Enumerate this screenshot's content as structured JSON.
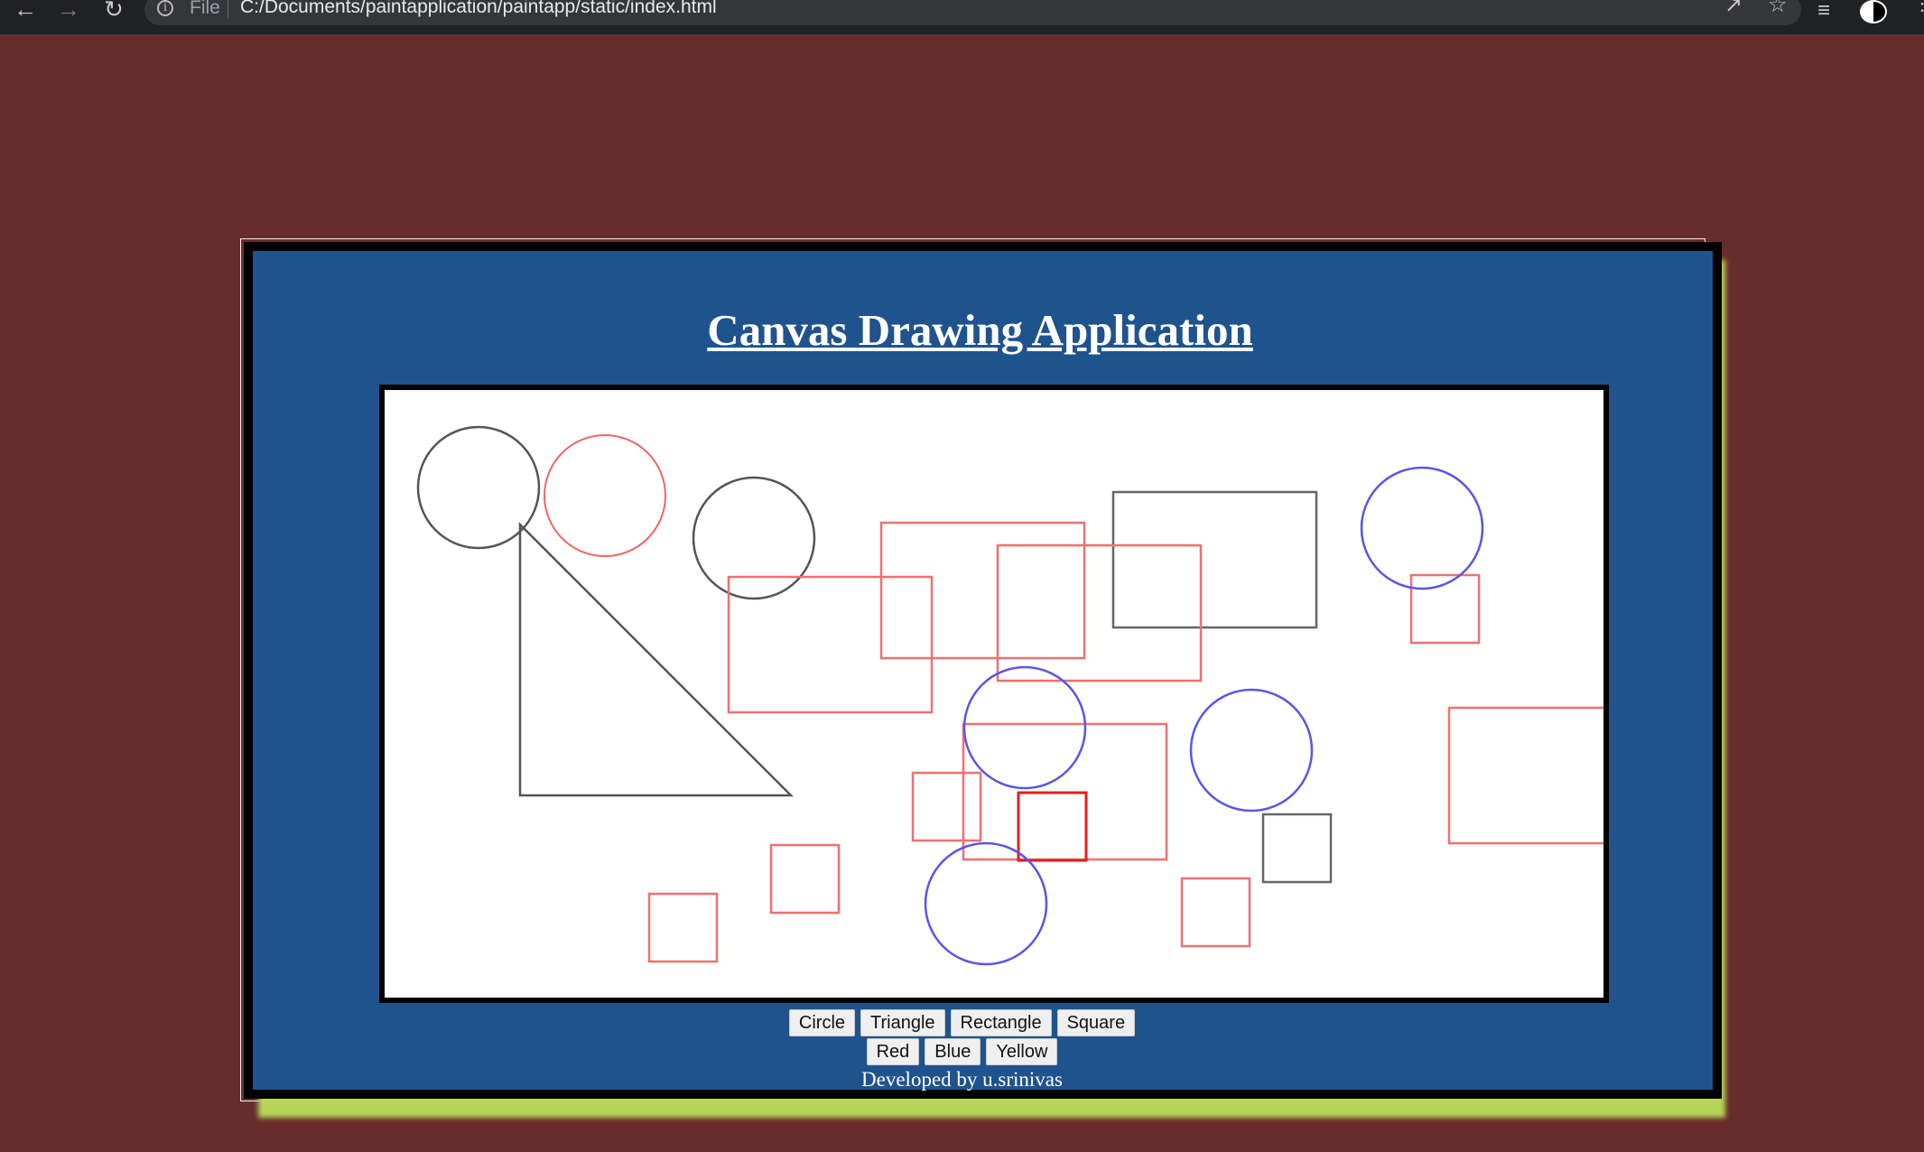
{
  "browser": {
    "file_label": "File",
    "url": "C:/Documents/paintapplication/paintapp/static/index.html"
  },
  "page": {
    "title": "Canvas Drawing Application",
    "footer": "Developed by u.srinivas"
  },
  "shape_buttons": [
    {
      "label": "Circle",
      "name": "circle-button"
    },
    {
      "label": "Triangle",
      "name": "triangle-button"
    },
    {
      "label": "Rectangle",
      "name": "rectangle-button"
    },
    {
      "label": "Square",
      "name": "square-button"
    }
  ],
  "color_buttons": [
    {
      "label": "Red",
      "name": "red-button"
    },
    {
      "label": "Blue",
      "name": "blue-button"
    },
    {
      "label": "Yellow",
      "name": "yellow-button"
    }
  ],
  "colors": {
    "background": "#682c2d",
    "panel": "#1f538e",
    "shadow": "#b7d659",
    "stroke_gray": "#555555",
    "stroke_red": "#ee7070",
    "stroke_red_dark": "#dd2020",
    "stroke_blue": "#5b55e6"
  }
}
